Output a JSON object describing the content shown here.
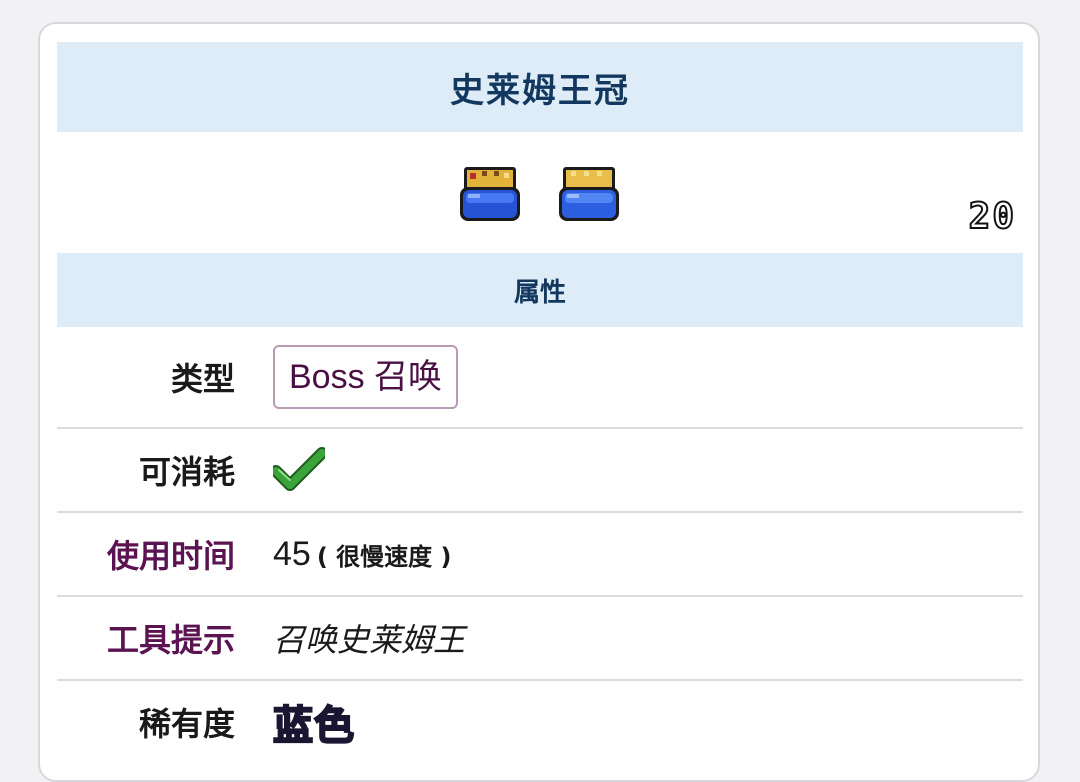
{
  "item": {
    "title": "史莱姆王冠",
    "stack_count": "20"
  },
  "sections": {
    "properties": "属性"
  },
  "rows": {
    "type": {
      "label": "类型",
      "value": "Boss 召唤"
    },
    "consumable": {
      "label": "可消耗",
      "icon": "checkmark-icon"
    },
    "use_time": {
      "label": "使用时间",
      "number": "45",
      "note": "( 很慢速度 )"
    },
    "tooltip": {
      "label": "工具提示",
      "value": "召唤史莱姆王"
    },
    "rarity": {
      "label": "稀有度",
      "value": "蓝色"
    }
  },
  "colors": {
    "header_bg": "#deecf7",
    "header_text": "#12385f",
    "label_purple": "#5c1351",
    "type_border": "#b89bb3",
    "check_green": "#3aa33a",
    "rarity_blue": "#a9a2ec"
  }
}
